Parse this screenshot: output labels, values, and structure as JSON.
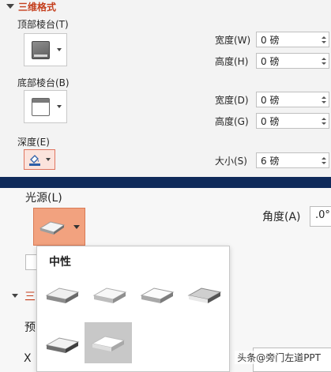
{
  "section": {
    "title": "三维格式"
  },
  "top_bevel": {
    "label": "顶部棱台(T)",
    "width": {
      "label": "宽度(W)",
      "value": "0 磅"
    },
    "height": {
      "label": "高度(H)",
      "value": "0 磅"
    }
  },
  "bottom_bevel": {
    "label": "底部棱台(B)",
    "width": {
      "label": "宽度(D)",
      "value": "0 磅"
    },
    "height": {
      "label": "高度(G)",
      "value": "0 磅"
    }
  },
  "depth": {
    "label": "深度(E)",
    "size_label": "大小(S)",
    "size_value": "6 磅"
  },
  "lighting": {
    "label": "光源(L)",
    "angle_label": "角度(A)",
    "angle_value": ".0°",
    "partial_letters": {
      "left1": "三",
      "left2": "预",
      "left3": "X"
    },
    "dropdown": {
      "group_title": "中性",
      "options": [
        {
          "name": "neutral-preset-1",
          "selected": false
        },
        {
          "name": "neutral-preset-2",
          "selected": false
        },
        {
          "name": "neutral-preset-3",
          "selected": false
        },
        {
          "name": "neutral-preset-4",
          "selected": false
        },
        {
          "name": "neutral-preset-5",
          "selected": false
        },
        {
          "name": "neutral-preset-6",
          "selected": true
        }
      ]
    }
  },
  "watermark": "头条@旁门左道PPT",
  "colors": {
    "accent": "#c43e1c",
    "divider": "#0f2a5a",
    "selected_button": "#f2a27f"
  }
}
